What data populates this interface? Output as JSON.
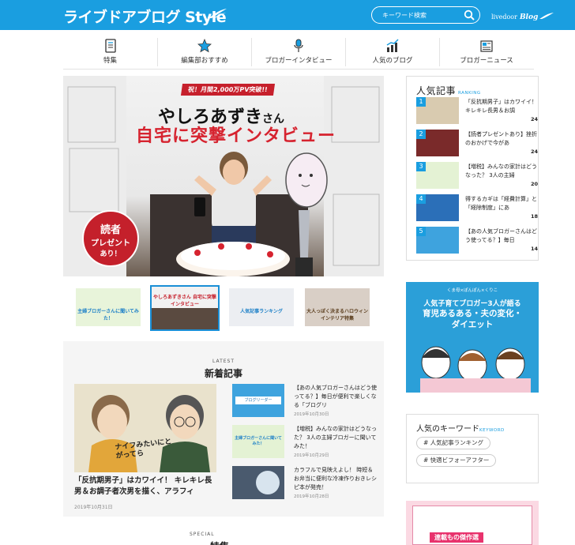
{
  "header": {
    "logo": "ライブドアブログ Style",
    "search_placeholder": "キーワード検索",
    "brand_prefix": "livedoor",
    "brand_suffix": "Blog"
  },
  "nav": [
    {
      "label": "特集",
      "icon": "notebook-icon"
    },
    {
      "label": "編集部おすすめ",
      "icon": "star-icon"
    },
    {
      "label": "ブロガーインタビュー",
      "icon": "microphone-icon"
    },
    {
      "label": "人気のブログ",
      "icon": "rising-chart-icon"
    },
    {
      "label": "ブロガーニュース",
      "icon": "newspaper-icon"
    }
  ],
  "hero": {
    "badge": "祝！月間2,000万PV突破!!",
    "name": "やしろあずき",
    "name_suffix": "さん",
    "title": "自宅に突撃インタビュー",
    "circle_line1": "読者",
    "circle_line2": "プレゼント",
    "circle_line3": "あり！"
  },
  "thumbs": [
    {
      "text": "主婦ブロガーさんに聞いてみた！"
    },
    {
      "text": "やしろあずきさん 自宅に突撃インタビュー"
    },
    {
      "text": "人気記事ランキング"
    },
    {
      "text": "大人っぽく決まるハロウィンインテリア特集"
    }
  ],
  "latest": {
    "label_en": "LATEST",
    "label_jp": "新着記事",
    "feature": {
      "title": "「反抗期男子」はカワイイ！ キレキレ長男＆お調子者次男を描く、アラフィ",
      "date": "2019年10月31日",
      "image_caption": "ナイフみたいにとがってら"
    },
    "items": [
      {
        "title": "【あの人気ブロガーさんはどう使ってる？】毎日が便利で楽しくなる「ブログリ",
        "date": "2019年10月30日",
        "thumb": "ブログリーダー"
      },
      {
        "title": "【増税】みんなの家計はどうなった？ 3人の主婦ブロガーに聞いてみた！",
        "date": "2019年10月29日",
        "thumb": "主婦ブロガーさんに聞いてみた！"
      },
      {
        "title": "カラフルで見映えよし！ 時短＆お弁当に便利な冷凍作りおきレシピ本が発売！",
        "date": "2019年10月28日",
        "thumb": ""
      }
    ]
  },
  "special": {
    "label_en": "SPECIAL",
    "label_jp": "特集"
  },
  "ranking": {
    "title": "人気記事",
    "title_en": "RANKING",
    "items": [
      {
        "num": "1",
        "text": "「反抗期男子」はカワイイ！ キレキレ長男＆お調",
        "count": "24"
      },
      {
        "num": "2",
        "text": "【読者プレゼントあり】挫折のおかげで今があ",
        "count": "24"
      },
      {
        "num": "3",
        "text": "【増税】みんなの家計はどうなった？ 3人の主婦",
        "count": "20"
      },
      {
        "num": "4",
        "text": "得するカギは「経費計算」と「経除制度」にあ",
        "count": "18"
      },
      {
        "num": "5",
        "text": "【あの人気ブロガーさんはどう使ってる？】毎日",
        "count": "14"
      }
    ]
  },
  "ad1": {
    "top": "くま母×ぽんぽん×くりこ",
    "line1": "人気子育てブロガー3人が語る",
    "line2": "育児あるある・夫の変化・",
    "line3": "ダイエット"
  },
  "keywords": {
    "title": "人気のキーワード",
    "title_en": "KEYWORD",
    "tags": [
      "# 人気記事ランキング",
      "# 快適ビフォーアフター"
    ]
  },
  "ad2": {
    "text": "連載もの傑作選"
  },
  "colors": {
    "brand": "#1a9ee0",
    "accent_red": "#d6232f"
  }
}
